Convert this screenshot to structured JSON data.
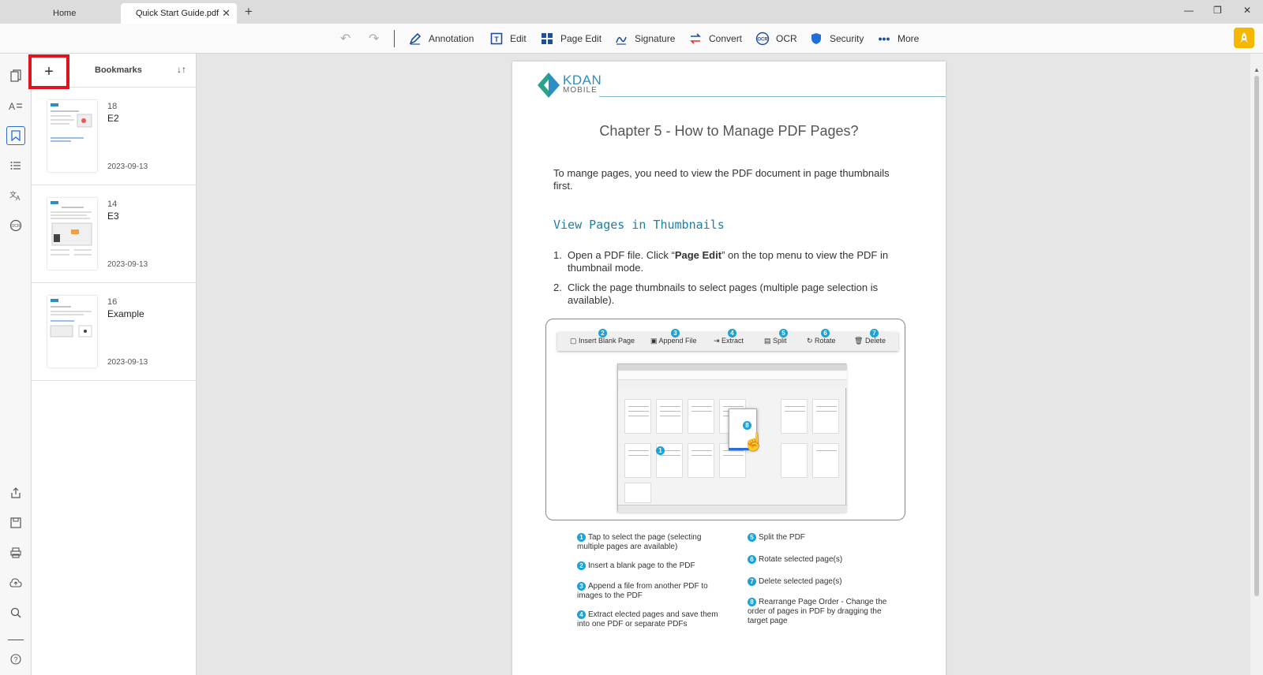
{
  "tabs": {
    "home": "Home",
    "active": "Quick Start Guide.pdf"
  },
  "toolbar": {
    "annotation": "Annotation",
    "edit": "Edit",
    "page_edit": "Page Edit",
    "signature": "Signature",
    "convert": "Convert",
    "ocr": "OCR",
    "security": "Security",
    "more": "More"
  },
  "bookmarks_panel": {
    "title": "Bookmarks",
    "items": [
      {
        "page": "18",
        "name": "E2",
        "date": "2023-09-13"
      },
      {
        "page": "14",
        "name": "E3",
        "date": "2023-09-13"
      },
      {
        "page": "16",
        "name": "Example",
        "date": "2023-09-13"
      }
    ]
  },
  "document": {
    "logo_main": "KDAN",
    "logo_sub": "MOBILE",
    "chapter_title": "Chapter 5 - How to Manage PDF Pages?",
    "intro": "To mange pages, you need to view the PDF document in page thumbnails first.",
    "section_title": "View Pages in Thumbnails",
    "steps": [
      {
        "num": "1.",
        "before": "Open a PDF file. Click “",
        "bold": "Page Edit",
        "after": "” on the top menu to view the PDF in thumbnail mode."
      },
      {
        "num": "2.",
        "before": "Click the page thumbnails to select pages (multiple page selection is available).",
        "bold": "",
        "after": ""
      }
    ],
    "figure_toolbar": [
      {
        "num": "2",
        "label": "Insert Blank Page"
      },
      {
        "num": "3",
        "label": "Append File"
      },
      {
        "num": "4",
        "label": "Extract"
      },
      {
        "num": "5",
        "label": "Split"
      },
      {
        "num": "6",
        "label": "Rotate"
      },
      {
        "num": "7",
        "label": "Delete"
      }
    ],
    "legend_left": [
      {
        "num": "1",
        "text": "Tap to select the page (selecting multiple pages are available)"
      },
      {
        "num": "2",
        "text": "Insert a blank page to the PDF"
      },
      {
        "num": "3",
        "text": "Append a file from another PDF to images to the PDF"
      },
      {
        "num": "4",
        "text": "Extract elected pages and save them into one PDF or separate PDFs"
      }
    ],
    "legend_right": [
      {
        "num": "5",
        "text": "Split the PDF"
      },
      {
        "num": "6",
        "text": "Rotate selected page(s)"
      },
      {
        "num": "7",
        "text": "Delete selected page(s)"
      },
      {
        "num": "8",
        "text": "Rearrange Page Order - Change the order of pages in PDF by dragging the target page"
      }
    ]
  },
  "colors": {
    "accent": "#2a6fd6",
    "highlight_box": "#e0141e",
    "figure_badge": "#1ea1d6",
    "section_title": "#1b7fa8"
  },
  "icons": {
    "rail_top": [
      "pages-icon",
      "text-edit-icon",
      "bookmark-icon",
      "outline-icon",
      "translate-icon",
      "ocr-rail-icon"
    ],
    "rail_bottom": [
      "share-icon",
      "save-as-icon",
      "print-icon",
      "cloud-upload-icon",
      "search-icon",
      "help-icon"
    ]
  }
}
